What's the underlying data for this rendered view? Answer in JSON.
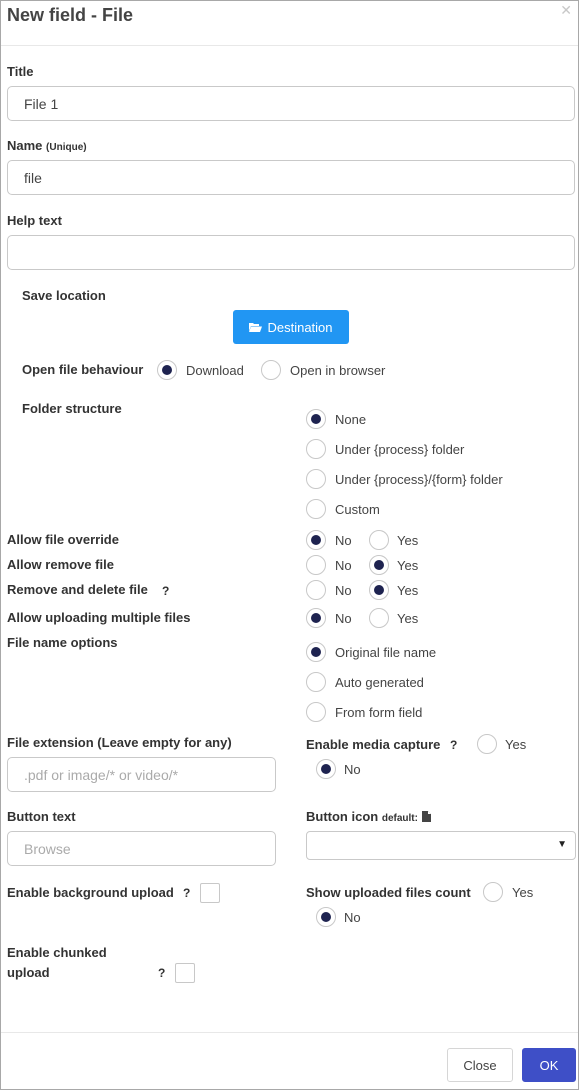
{
  "dialog": {
    "title": "New field - File",
    "close_icon": "close-x"
  },
  "fields": {
    "title": {
      "label": "Title",
      "value": "File 1"
    },
    "name": {
      "label": "Name",
      "label_suffix": "(Unique)",
      "value": "file"
    },
    "help_text": {
      "label": "Help text",
      "value": ""
    },
    "save_location": {
      "label": "Save location",
      "button_label": "Destination",
      "button_icon": "folder-open-icon"
    },
    "open_file_behaviour": {
      "label": "Open file behaviour",
      "options": [
        "Download",
        "Open in browser"
      ],
      "selected": "Download"
    },
    "folder_structure": {
      "label": "Folder structure",
      "options": [
        "None",
        "Under {process} folder",
        "Under {process}/{form} folder",
        "Custom"
      ],
      "selected": "None"
    },
    "allow_file_override": {
      "label": "Allow file override",
      "options": [
        "No",
        "Yes"
      ],
      "selected": "No"
    },
    "allow_remove_file": {
      "label": "Allow remove file",
      "options": [
        "No",
        "Yes"
      ],
      "selected": "Yes"
    },
    "remove_and_delete_file": {
      "label": "Remove and delete file",
      "help": "?",
      "options": [
        "No",
        "Yes"
      ],
      "selected": "Yes"
    },
    "allow_uploading_multiple_files": {
      "label": "Allow uploading multiple files",
      "options": [
        "No",
        "Yes"
      ],
      "selected": "No"
    },
    "file_name_options": {
      "label": "File name options",
      "options": [
        "Original file name",
        "Auto generated",
        "From form field"
      ],
      "selected": "Original file name"
    },
    "file_extension": {
      "label": "File extension (Leave empty for any)",
      "placeholder": ".pdf or image/* or video/*",
      "value": ""
    },
    "enable_media_capture": {
      "label": "Enable media capture",
      "help": "?",
      "options": [
        "Yes",
        "No"
      ],
      "selected": "No"
    },
    "button_text": {
      "label": "Button text",
      "placeholder": "Browse",
      "value": ""
    },
    "button_icon": {
      "label": "Button icon",
      "default_label": "default:",
      "default_icon": "file-icon",
      "selected": ""
    },
    "enable_background_upload": {
      "label": "Enable background upload",
      "help": "?",
      "checked": false
    },
    "show_uploaded_files_count": {
      "label": "Show uploaded files count",
      "options": [
        "Yes",
        "No"
      ],
      "selected": "No"
    },
    "enable_chunked_upload": {
      "label_line1": "Enable chunked",
      "label_line2": "upload",
      "help": "?",
      "checked": false
    }
  },
  "footer": {
    "close_label": "Close",
    "ok_label": "OK"
  },
  "colors": {
    "primary": "#2196f3",
    "ok": "#3e4fc7",
    "radio_dot": "#1e2350"
  }
}
